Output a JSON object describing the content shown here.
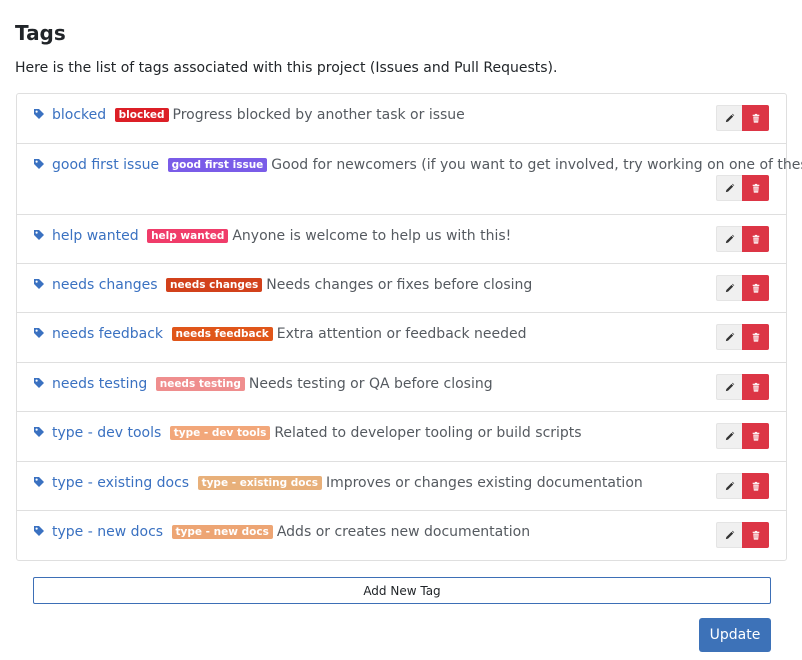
{
  "page": {
    "title": "Tags",
    "intro": "Here is the list of tags associated with this project (Issues and Pull Requests)."
  },
  "colors": {
    "link": "#3a71c1",
    "primary": "#3d72b8",
    "danger": "#dc3545"
  },
  "tags": [
    {
      "name": "blocked",
      "badge": "blocked",
      "badge_color": "#dc1f26",
      "description": "Progress blocked by another task or issue"
    },
    {
      "name": "good first issue",
      "badge": "good first issue",
      "badge_color": "#7a5ce8",
      "description": "Good for newcomers (if you want to get involved, try working on one of these!)"
    },
    {
      "name": "help wanted",
      "badge": "help wanted",
      "badge_color": "#f03c6a",
      "description": "Anyone is welcome to help us with this!"
    },
    {
      "name": "needs changes",
      "badge": "needs changes",
      "badge_color": "#d2411b",
      "description": "Needs changes or fixes before closing"
    },
    {
      "name": "needs feedback",
      "badge": "needs feedback",
      "badge_color": "#e0561a",
      "description": "Extra attention or feedback needed"
    },
    {
      "name": "needs testing",
      "badge": "needs testing",
      "badge_color": "#ef8e8e",
      "description": "Needs testing or QA before closing"
    },
    {
      "name": "type - dev tools",
      "badge": "type - dev tools",
      "badge_color": "#f2a77a",
      "description": "Related to developer tooling or build scripts"
    },
    {
      "name": "type - existing docs",
      "badge": "type - existing docs",
      "badge_color": "#e8b07a",
      "description": "Improves or changes existing documentation"
    },
    {
      "name": "type - new docs",
      "badge": "type - new docs",
      "badge_color": "#eda574",
      "description": "Adds or creates new documentation"
    }
  ],
  "icons": {
    "tag": "tag-icon",
    "edit": "pencil-icon",
    "delete": "trash-icon"
  },
  "buttons": {
    "add_new_tag": "Add New Tag",
    "update": "Update"
  }
}
